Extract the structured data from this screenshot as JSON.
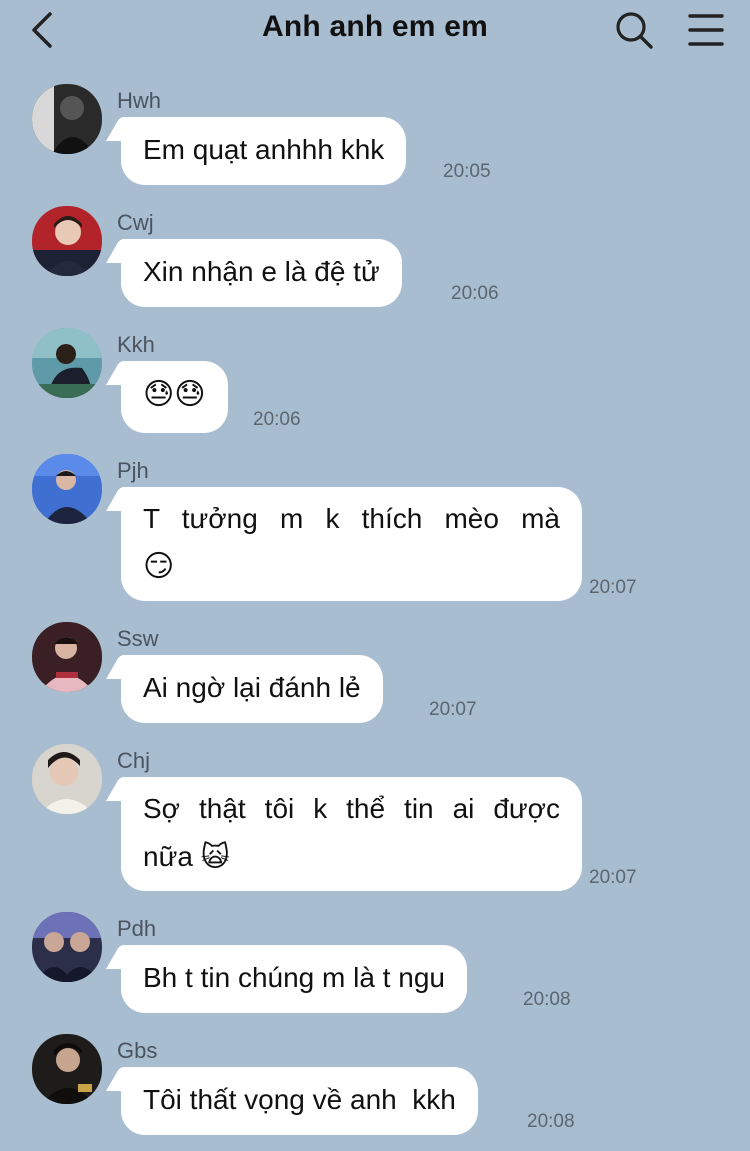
{
  "header": {
    "title": "Anh anh em em",
    "back_icon": "chevron-left-icon",
    "search_icon": "search-icon",
    "menu_icon": "menu-icon"
  },
  "messages": [
    {
      "sender": "Hwh",
      "text": "Em quạt anhhh khk",
      "time": "20:05"
    },
    {
      "sender": "Cwj",
      "text": "Xin nhận e là đệ tử",
      "time": "20:06"
    },
    {
      "sender": "Kkh",
      "text": "😓😓",
      "time": "20:06"
    },
    {
      "sender": "Pjh",
      "text": "T tưởng m k thích mèo mà",
      "text2": "😏",
      "time": "20:07"
    },
    {
      "sender": "Ssw",
      "text": "Ai ngờ lại đánh lẻ",
      "time": "20:07"
    },
    {
      "sender": "Chj",
      "text": "Sợ thật tôi k thể tin ai được",
      "text2": "nữa 🙀",
      "time": "20:07"
    },
    {
      "sender": "Pdh",
      "text": "Bh t tin chúng m là t ngu",
      "time": "20:08"
    },
    {
      "sender": "Gbs",
      "text": "Tôi thất vọng về anh  kkh",
      "time": "20:08"
    }
  ],
  "colors": {
    "background": "#a9bdd1",
    "bubble": "#ffffff",
    "time_text": "#5b6670"
  }
}
